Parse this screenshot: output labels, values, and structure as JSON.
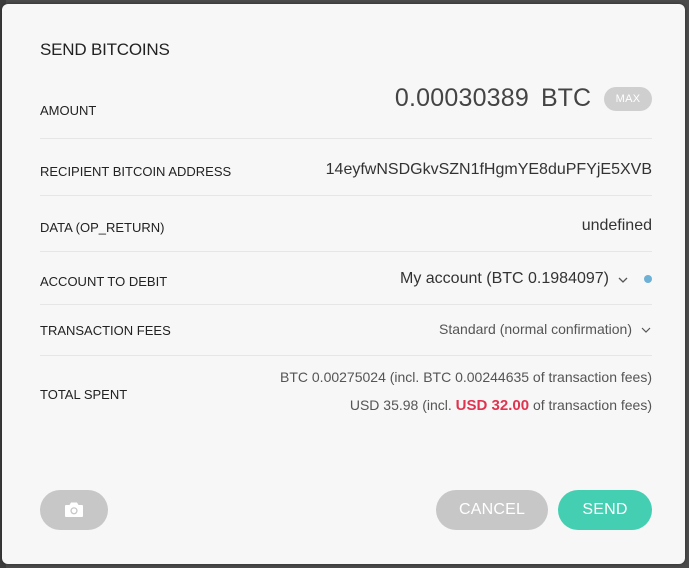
{
  "modal": {
    "title": "SEND BITCOINS"
  },
  "amount": {
    "label": "AMOUNT",
    "value": "0.00030389",
    "unit": "BTC",
    "max_label": "MAX"
  },
  "recipient": {
    "label": "RECIPIENT BITCOIN ADDRESS",
    "value": "14eyfwNSDGkvSZN1fHgmYE8duPFYjE5XVB"
  },
  "data_field": {
    "label": "DATA (OP_RETURN)",
    "value": "undefined"
  },
  "account": {
    "label": "ACCOUNT TO DEBIT",
    "value": "My account (BTC 0.1984097)",
    "status_color": "#6eb1d6"
  },
  "fees": {
    "label": "TRANSACTION FEES",
    "value": "Standard (normal confirmation)"
  },
  "total": {
    "label": "TOTAL SPENT",
    "btc_line": "BTC 0.00275024 (incl. BTC 0.00244635 of transaction fees)",
    "usd_prefix": "USD 35.98 (incl.",
    "usd_fee": "USD 32.00",
    "usd_suffix": "of transaction fees)",
    "fee_color": "#e0334f"
  },
  "buttons": {
    "camera_icon": "camera-icon",
    "cancel_label": "CANCEL",
    "send_label": "SEND",
    "send_color": "#45cfb2"
  }
}
